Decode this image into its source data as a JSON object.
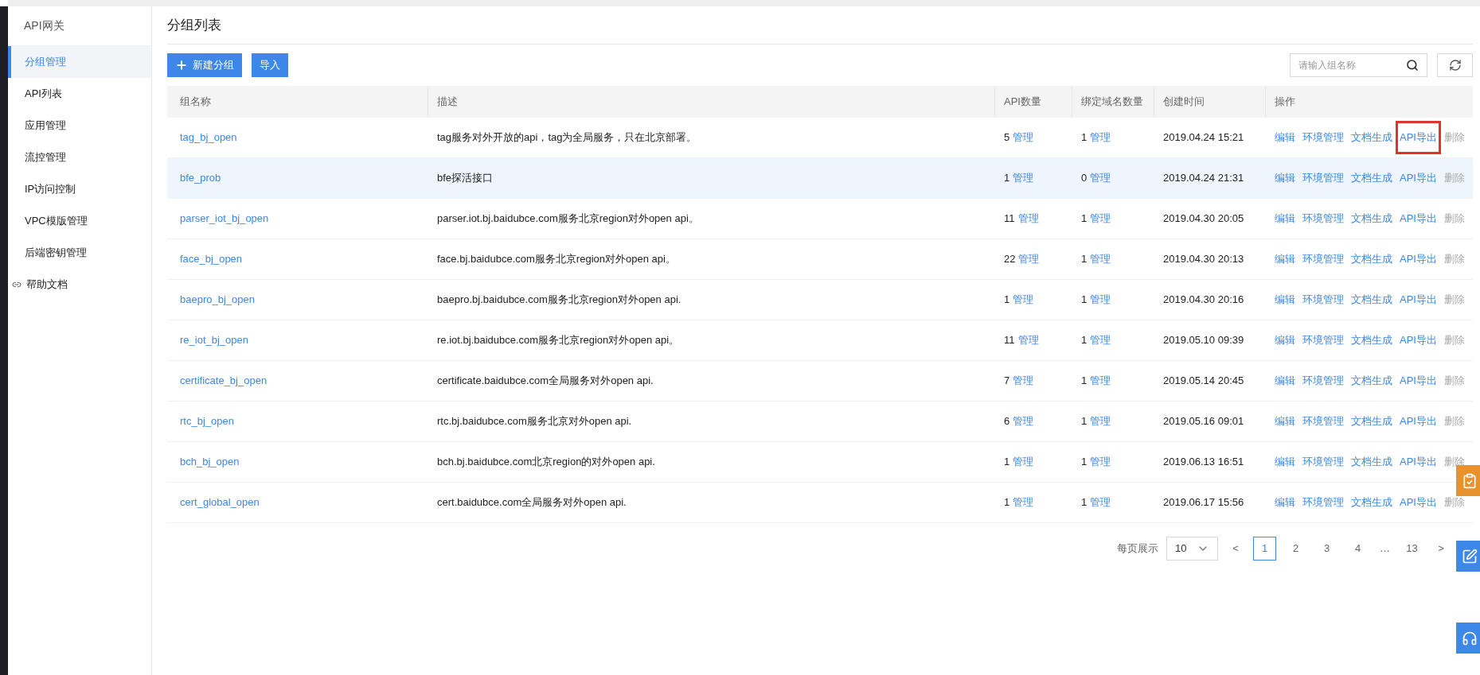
{
  "sidebar": {
    "title": "API网关",
    "items": [
      {
        "label": "分组管理",
        "selected": true,
        "kind": "plain"
      },
      {
        "label": "API列表",
        "selected": false,
        "kind": "plain"
      },
      {
        "label": "应用管理",
        "selected": false,
        "kind": "plain"
      },
      {
        "label": "流控管理",
        "selected": false,
        "kind": "plain"
      },
      {
        "label": "IP访问控制",
        "selected": false,
        "kind": "plain"
      },
      {
        "label": "VPC模版管理",
        "selected": false,
        "kind": "plain"
      },
      {
        "label": "后端密钥管理",
        "selected": false,
        "kind": "plain"
      },
      {
        "label": "帮助文档",
        "selected": false,
        "kind": "link"
      }
    ]
  },
  "page_title": "分组列表",
  "toolbar": {
    "buttons": [
      {
        "label": "新建分组",
        "kind": "add"
      },
      {
        "label": "导入",
        "kind": "plain"
      }
    ],
    "search": {
      "placeholder": "请输入组名称"
    }
  },
  "table": {
    "columns": [
      "组名称",
      "描述",
      "API数量",
      "绑定域名数量",
      "创建时间",
      "操作"
    ],
    "rows": [
      {
        "name": "tag_bj_open",
        "description": "tag服务对外开放的api，tag为全局服务，只在北京部署。",
        "api_count": "5",
        "api_link": "管理",
        "domain_count": "1",
        "domain_link": "管理",
        "created": "2019.04.24 15:21",
        "hovered": false,
        "actions": [
          {
            "label": "编辑",
            "disabled": false,
            "highlighted": false
          },
          {
            "label": "环境管理",
            "disabled": false,
            "highlighted": false
          },
          {
            "label": "文档生成",
            "disabled": false,
            "highlighted": false
          },
          {
            "label": "API导出",
            "disabled": false,
            "highlighted": true
          },
          {
            "label": "删除",
            "disabled": true,
            "highlighted": false
          }
        ]
      },
      {
        "name": "bfe_prob",
        "description": "bfe探活接口",
        "api_count": "1",
        "api_link": "管理",
        "domain_count": "0",
        "domain_link": "管理",
        "created": "2019.04.24 21:31",
        "hovered": true,
        "actions": [
          {
            "label": "编辑",
            "disabled": false,
            "highlighted": false
          },
          {
            "label": "环境管理",
            "disabled": false,
            "highlighted": false
          },
          {
            "label": "文档生成",
            "disabled": false,
            "highlighted": false
          },
          {
            "label": "API导出",
            "disabled": false,
            "highlighted": false
          },
          {
            "label": "删除",
            "disabled": true,
            "highlighted": false
          }
        ]
      },
      {
        "name": "parser_iot_bj_open",
        "description": "parser.iot.bj.baidubce.com服务北京region对外open api。",
        "api_count": "11",
        "api_link": "管理",
        "domain_count": "1",
        "domain_link": "管理",
        "created": "2019.04.30 20:05",
        "hovered": false,
        "actions": [
          {
            "label": "编辑",
            "disabled": false,
            "highlighted": false
          },
          {
            "label": "环境管理",
            "disabled": false,
            "highlighted": false
          },
          {
            "label": "文档生成",
            "disabled": false,
            "highlighted": false
          },
          {
            "label": "API导出",
            "disabled": false,
            "highlighted": false
          },
          {
            "label": "删除",
            "disabled": true,
            "highlighted": false
          }
        ]
      },
      {
        "name": "face_bj_open",
        "description": "face.bj.baidubce.com服务北京region对外open api。",
        "api_count": "22",
        "api_link": "管理",
        "domain_count": "1",
        "domain_link": "管理",
        "created": "2019.04.30 20:13",
        "hovered": false,
        "actions": [
          {
            "label": "编辑",
            "disabled": false,
            "highlighted": false
          },
          {
            "label": "环境管理",
            "disabled": false,
            "highlighted": false
          },
          {
            "label": "文档生成",
            "disabled": false,
            "highlighted": false
          },
          {
            "label": "API导出",
            "disabled": false,
            "highlighted": false
          },
          {
            "label": "删除",
            "disabled": true,
            "highlighted": false
          }
        ]
      },
      {
        "name": "baepro_bj_open",
        "description": "baepro.bj.baidubce.com服务北京region对外open api.",
        "api_count": "1",
        "api_link": "管理",
        "domain_count": "1",
        "domain_link": "管理",
        "created": "2019.04.30 20:16",
        "hovered": false,
        "actions": [
          {
            "label": "编辑",
            "disabled": false,
            "highlighted": false
          },
          {
            "label": "环境管理",
            "disabled": false,
            "highlighted": false
          },
          {
            "label": "文档生成",
            "disabled": false,
            "highlighted": false
          },
          {
            "label": "API导出",
            "disabled": false,
            "highlighted": false
          },
          {
            "label": "删除",
            "disabled": true,
            "highlighted": false
          }
        ]
      },
      {
        "name": "re_iot_bj_open",
        "description": "re.iot.bj.baidubce.com服务北京region对外open api。",
        "api_count": "11",
        "api_link": "管理",
        "domain_count": "1",
        "domain_link": "管理",
        "created": "2019.05.10 09:39",
        "hovered": false,
        "actions": [
          {
            "label": "编辑",
            "disabled": false,
            "highlighted": false
          },
          {
            "label": "环境管理",
            "disabled": false,
            "highlighted": false
          },
          {
            "label": "文档生成",
            "disabled": false,
            "highlighted": false
          },
          {
            "label": "API导出",
            "disabled": false,
            "highlighted": false
          },
          {
            "label": "删除",
            "disabled": true,
            "highlighted": false
          }
        ]
      },
      {
        "name": "certificate_bj_open",
        "description": "certificate.baidubce.com全局服务对外open api.",
        "api_count": "7",
        "api_link": "管理",
        "domain_count": "1",
        "domain_link": "管理",
        "created": "2019.05.14 20:45",
        "hovered": false,
        "actions": [
          {
            "label": "编辑",
            "disabled": false,
            "highlighted": false
          },
          {
            "label": "环境管理",
            "disabled": false,
            "highlighted": false
          },
          {
            "label": "文档生成",
            "disabled": false,
            "highlighted": false
          },
          {
            "label": "API导出",
            "disabled": false,
            "highlighted": false
          },
          {
            "label": "删除",
            "disabled": true,
            "highlighted": false
          }
        ]
      },
      {
        "name": "rtc_bj_open",
        "description": "rtc.bj.baidubce.com服务北京对外open api.",
        "api_count": "6",
        "api_link": "管理",
        "domain_count": "1",
        "domain_link": "管理",
        "created": "2019.05.16 09:01",
        "hovered": false,
        "actions": [
          {
            "label": "编辑",
            "disabled": false,
            "highlighted": false
          },
          {
            "label": "环境管理",
            "disabled": false,
            "highlighted": false
          },
          {
            "label": "文档生成",
            "disabled": false,
            "highlighted": false
          },
          {
            "label": "API导出",
            "disabled": false,
            "highlighted": false
          },
          {
            "label": "删除",
            "disabled": true,
            "highlighted": false
          }
        ]
      },
      {
        "name": "bch_bj_open",
        "description": "bch.bj.baidubce.com北京region的对外open api.",
        "api_count": "1",
        "api_link": "管理",
        "domain_count": "1",
        "domain_link": "管理",
        "created": "2019.06.13 16:51",
        "hovered": false,
        "actions": [
          {
            "label": "编辑",
            "disabled": false,
            "highlighted": false
          },
          {
            "label": "环境管理",
            "disabled": false,
            "highlighted": false
          },
          {
            "label": "文档生成",
            "disabled": false,
            "highlighted": false
          },
          {
            "label": "API导出",
            "disabled": false,
            "highlighted": false
          },
          {
            "label": "删除",
            "disabled": true,
            "highlighted": false
          }
        ]
      },
      {
        "name": "cert_global_open",
        "description": "cert.baidubce.com全局服务对外open api.",
        "api_count": "1",
        "api_link": "管理",
        "domain_count": "1",
        "domain_link": "管理",
        "created": "2019.06.17 15:56",
        "hovered": false,
        "actions": [
          {
            "label": "编辑",
            "disabled": false,
            "highlighted": false
          },
          {
            "label": "环境管理",
            "disabled": false,
            "highlighted": false
          },
          {
            "label": "文档生成",
            "disabled": false,
            "highlighted": false
          },
          {
            "label": "API导出",
            "disabled": false,
            "highlighted": false
          },
          {
            "label": "删除",
            "disabled": true,
            "highlighted": false
          }
        ]
      }
    ]
  },
  "pagination": {
    "page_size_label": "每页展示",
    "page_size": "10",
    "prev": "<",
    "next": ">",
    "pages": [
      {
        "label": "1",
        "selected": true,
        "kind": "page"
      },
      {
        "label": "2",
        "selected": false,
        "kind": "page"
      },
      {
        "label": "3",
        "selected": false,
        "kind": "page"
      },
      {
        "label": "4",
        "selected": false,
        "kind": "page"
      },
      {
        "label": "…",
        "kind": "ellipsis"
      },
      {
        "label": "13",
        "selected": false,
        "kind": "page"
      }
    ]
  },
  "floating_buttons": [
    {
      "kind": "checklist",
      "color": "#e8922e"
    },
    {
      "kind": "edit",
      "color": "#3d87e8"
    },
    {
      "kind": "headset",
      "color": "#3d87e8"
    }
  ]
}
